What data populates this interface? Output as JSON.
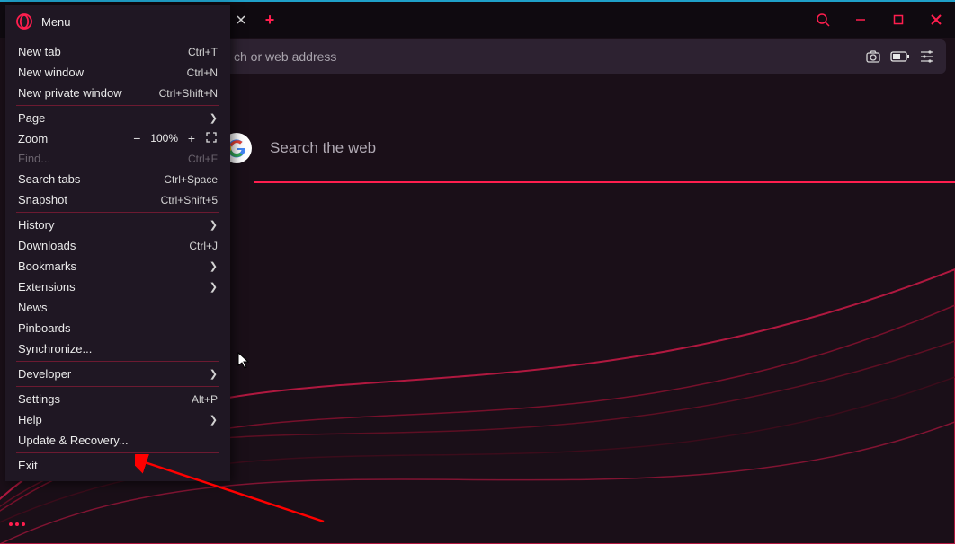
{
  "menu": {
    "title": "Menu",
    "groups": [
      [
        {
          "label": "New tab",
          "shortcut": "Ctrl+T"
        },
        {
          "label": "New window",
          "shortcut": "Ctrl+N"
        },
        {
          "label": "New private window",
          "shortcut": "Ctrl+Shift+N"
        }
      ],
      [
        {
          "label": "Page",
          "submenu": true
        },
        {
          "label": "Zoom",
          "zoom": true,
          "value": "100%"
        },
        {
          "label": "Find...",
          "shortcut": "Ctrl+F",
          "disabled": true
        },
        {
          "label": "Search tabs",
          "shortcut": "Ctrl+Space"
        },
        {
          "label": "Snapshot",
          "shortcut": "Ctrl+Shift+5"
        }
      ],
      [
        {
          "label": "History",
          "submenu": true
        },
        {
          "label": "Downloads",
          "shortcut": "Ctrl+J"
        },
        {
          "label": "Bookmarks",
          "submenu": true
        },
        {
          "label": "Extensions",
          "submenu": true
        },
        {
          "label": "News"
        },
        {
          "label": "Pinboards"
        },
        {
          "label": "Synchronize..."
        }
      ],
      [
        {
          "label": "Developer",
          "submenu": true
        }
      ],
      [
        {
          "label": "Settings",
          "shortcut": "Alt+P"
        },
        {
          "label": "Help",
          "submenu": true
        },
        {
          "label": "Update & Recovery..."
        }
      ],
      [
        {
          "label": "Exit"
        }
      ]
    ]
  },
  "addressbar": {
    "placeholder_fragment": "ch or web address"
  },
  "search": {
    "placeholder": "Search the web"
  }
}
